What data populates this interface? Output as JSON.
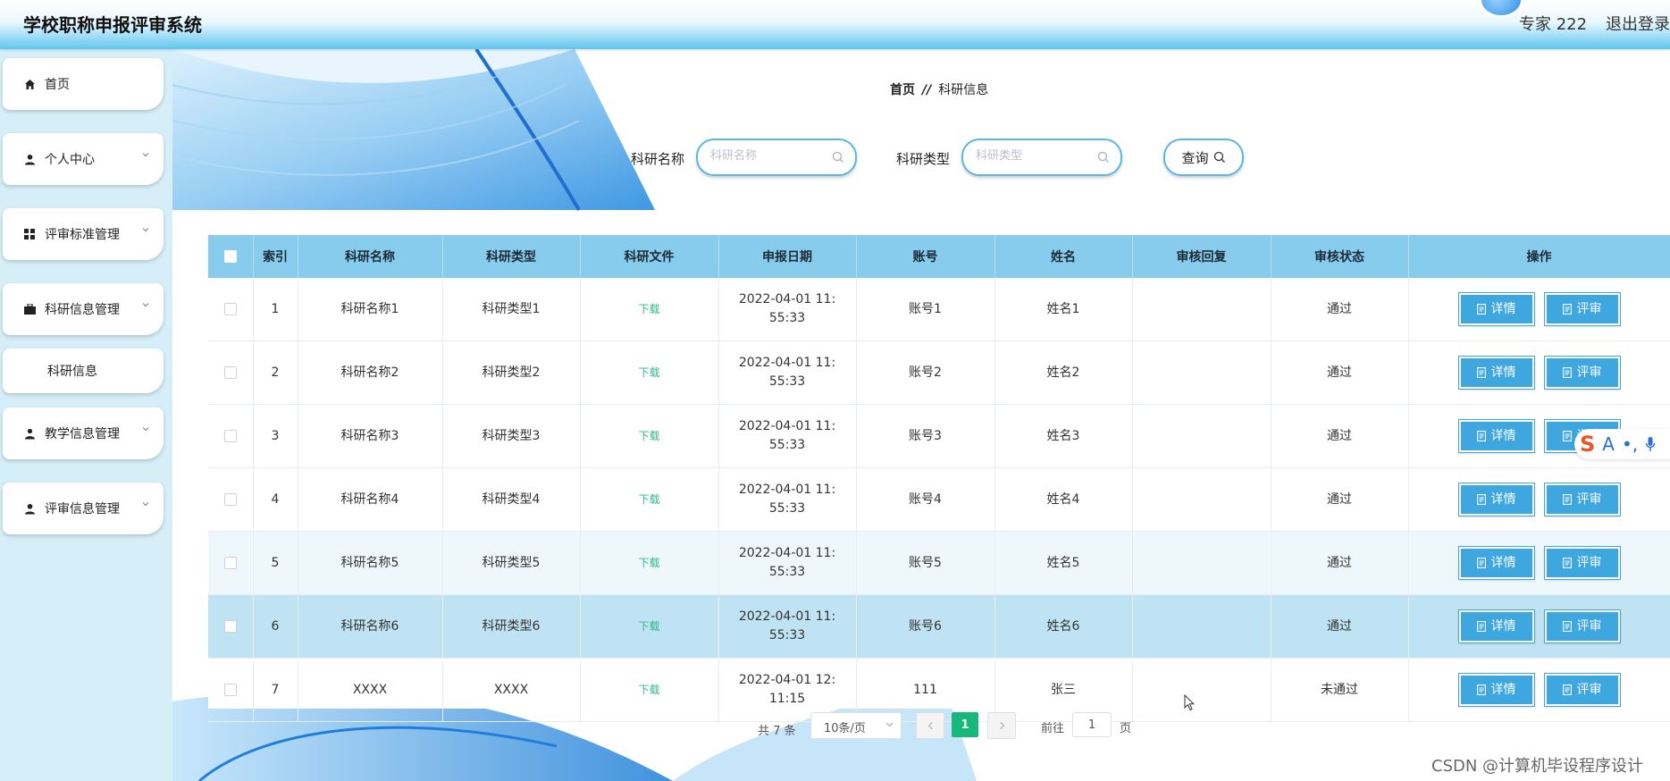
{
  "app": {
    "title": "学校职称申报评审系统"
  },
  "header": {
    "user": "专家 222",
    "logout": "退出登录"
  },
  "sidebar": {
    "items": [
      {
        "label": "首页",
        "icon": "home-icon",
        "has_arrow": false
      },
      {
        "label": "个人中心",
        "icon": "user-icon",
        "has_arrow": true
      },
      {
        "label": "评审标准管理",
        "icon": "grid-icon",
        "has_arrow": true
      },
      {
        "label": "科研信息管理",
        "icon": "briefcase-icon",
        "has_arrow": true
      },
      {
        "label": "科研信息",
        "icon": "",
        "has_arrow": false
      },
      {
        "label": "教学信息管理",
        "icon": "teacher-icon",
        "has_arrow": true
      },
      {
        "label": "评审信息管理",
        "icon": "user-icon",
        "has_arrow": true
      }
    ]
  },
  "breadcrumb": {
    "home": "首页",
    "separator": "//",
    "current": "科研信息"
  },
  "search": {
    "name_label": "科研名称",
    "name_placeholder": "科研名称",
    "type_label": "科研类型",
    "type_placeholder": "科研类型",
    "query_label": "查询"
  },
  "table": {
    "headers": [
      "",
      "索引",
      "科研名称",
      "科研类型",
      "科研文件",
      "申报日期",
      "账号",
      "姓名",
      "审核回复",
      "审核状态",
      "操作"
    ],
    "rows": [
      {
        "index": "1",
        "name": "科研名称1",
        "type": "科研类型1",
        "file": "下载",
        "date": "2022-04-01 11:55:33",
        "account": "账号1",
        "person": "姓名1",
        "reply": "",
        "status": "通过"
      },
      {
        "index": "2",
        "name": "科研名称2",
        "type": "科研类型2",
        "file": "下载",
        "date": "2022-04-01 11:55:33",
        "account": "账号2",
        "person": "姓名2",
        "reply": "",
        "status": "通过"
      },
      {
        "index": "3",
        "name": "科研名称3",
        "type": "科研类型3",
        "file": "下载",
        "date": "2022-04-01 11:55:33",
        "account": "账号3",
        "person": "姓名3",
        "reply": "",
        "status": "通过"
      },
      {
        "index": "4",
        "name": "科研名称4",
        "type": "科研类型4",
        "file": "下载",
        "date": "2022-04-01 11:55:33",
        "account": "账号4",
        "person": "姓名4",
        "reply": "",
        "status": "通过"
      },
      {
        "index": "5",
        "name": "科研名称5",
        "type": "科研类型5",
        "file": "下载",
        "date": "2022-04-01 11:55:33",
        "account": "账号5",
        "person": "姓名5",
        "reply": "",
        "status": "通过"
      },
      {
        "index": "6",
        "name": "科研名称6",
        "type": "科研类型6",
        "file": "下载",
        "date": "2022-04-01 11:55:33",
        "account": "账号6",
        "person": "姓名6",
        "reply": "",
        "status": "通过"
      },
      {
        "index": "7",
        "name": "XXXX",
        "type": "XXXX",
        "file": "下载",
        "date": "2022-04-01 12:11:15",
        "account": "111",
        "person": "张三",
        "reply": "",
        "status": "未通过"
      }
    ],
    "action_detail": "详情",
    "action_review": "评审"
  },
  "pager": {
    "total": "共 7 条",
    "page_size": "10条/页",
    "current_page": "1",
    "goto_label": "前往",
    "goto_value": "1",
    "page_unit": "页"
  },
  "watermark": "CSDN @计算机毕设程序设计",
  "colors": {
    "header_accent": "#5fc6ee",
    "table_header": "#87ccec",
    "button": "#3ea7df",
    "download": "#2fb885",
    "active_page": "#16b87c"
  }
}
